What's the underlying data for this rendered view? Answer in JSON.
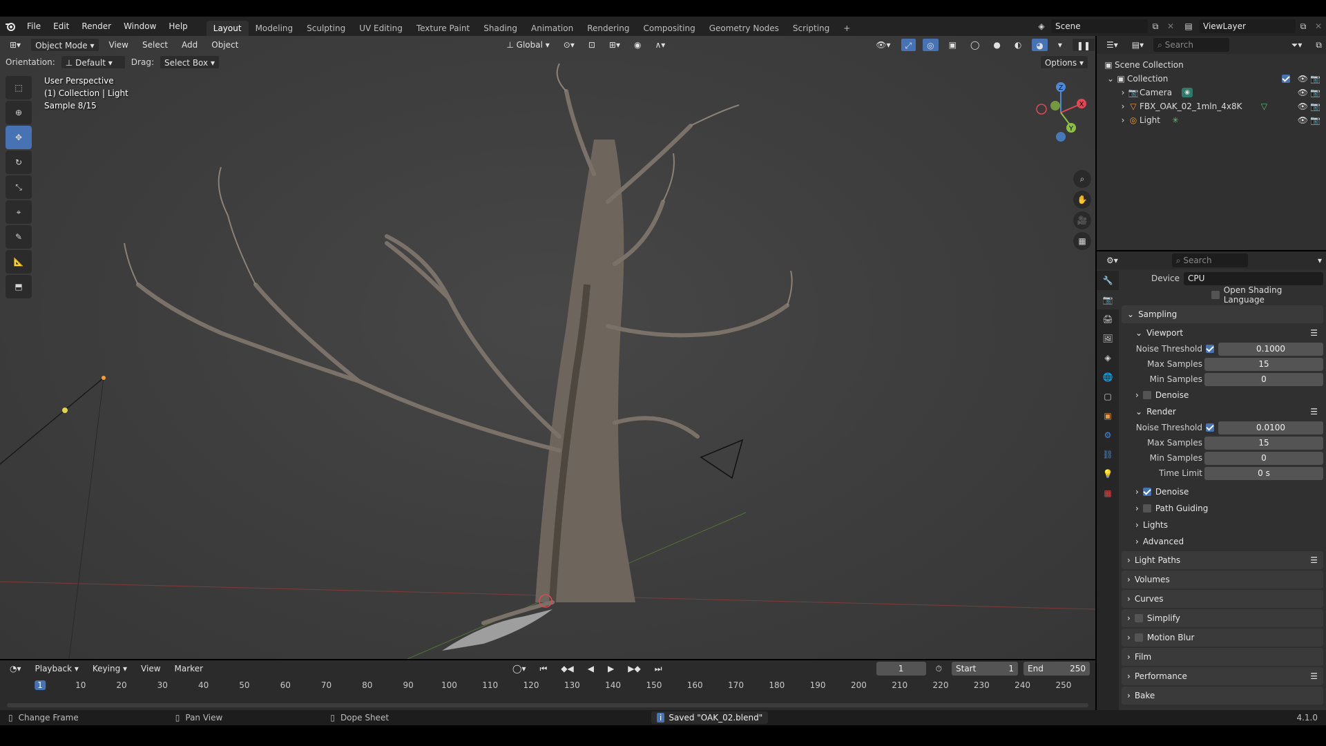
{
  "menus": [
    "File",
    "Edit",
    "Render",
    "Window",
    "Help"
  ],
  "workspaces": [
    "Layout",
    "Modeling",
    "Sculpting",
    "UV Editing",
    "Texture Paint",
    "Shading",
    "Animation",
    "Rendering",
    "Compositing",
    "Geometry Nodes",
    "Scripting"
  ],
  "active_workspace": "Layout",
  "scene_name": "Scene",
  "view_layer": "ViewLayer",
  "viewport": {
    "mode": "Object Mode",
    "header_menus": [
      "View",
      "Select",
      "Add",
      "Object"
    ],
    "transform_orientation": "Global",
    "orientation_label": "Orientation:",
    "orientation_value": "Default",
    "drag_label": "Drag:",
    "drag_value": "Select Box",
    "options_label": "Options",
    "info_line1": "User Perspective",
    "info_line2": "(1) Collection | Light",
    "info_line3": "Sample 8/15",
    "gizmo_axes": [
      "Z",
      "Y",
      "X"
    ]
  },
  "outliner": {
    "search_placeholder": "Search",
    "root": "Scene Collection",
    "collection": "Collection",
    "items": [
      {
        "name": "Camera",
        "icon": "camera-icon"
      },
      {
        "name": "FBX_OAK_02_1mln_4x8K",
        "icon": "mesh-icon"
      },
      {
        "name": "Light",
        "icon": "light-icon"
      }
    ]
  },
  "properties": {
    "search_placeholder": "Search",
    "device_label": "Device",
    "device_value": "CPU",
    "osl_label": "Open Shading Language",
    "sampling": "Sampling",
    "viewport_label": "Viewport",
    "render_label": "Render",
    "noise_threshold_label": "Noise Threshold",
    "max_samples_label": "Max Samples",
    "min_samples_label": "Min Samples",
    "time_limit_label": "Time Limit",
    "denoise_label": "Denoise",
    "viewport_noise": "0.1000",
    "viewport_max": "15",
    "viewport_min": "0",
    "render_noise": "0.0100",
    "render_max": "15",
    "render_min": "0",
    "render_time_limit": "0 s",
    "path_guiding": "Path Guiding",
    "lights": "Lights",
    "advanced": "Advanced",
    "panels": [
      "Light Paths",
      "Volumes",
      "Curves",
      "Simplify",
      "Motion Blur",
      "Film",
      "Performance",
      "Bake"
    ]
  },
  "timeline": {
    "menus": [
      "Playback",
      "Keying",
      "View",
      "Marker"
    ],
    "current_frame": "1",
    "start_label": "Start",
    "start": "1",
    "end_label": "End",
    "end": "250",
    "ticks": [
      "1",
      "10",
      "20",
      "30",
      "40",
      "50",
      "60",
      "70",
      "80",
      "90",
      "100",
      "110",
      "120",
      "130",
      "140",
      "150",
      "160",
      "170",
      "180",
      "190",
      "200",
      "210",
      "220",
      "230",
      "240",
      "250"
    ]
  },
  "status": {
    "left": "Change Frame",
    "middle": "Pan View",
    "right": "Dope Sheet",
    "message": "Saved \"OAK_02.blend\"",
    "version": "4.1.0"
  },
  "colors": {
    "accent": "#4772b3",
    "x_axis": "#e04854",
    "y_axis": "#8cc040",
    "z_axis": "#4a8ad8"
  }
}
